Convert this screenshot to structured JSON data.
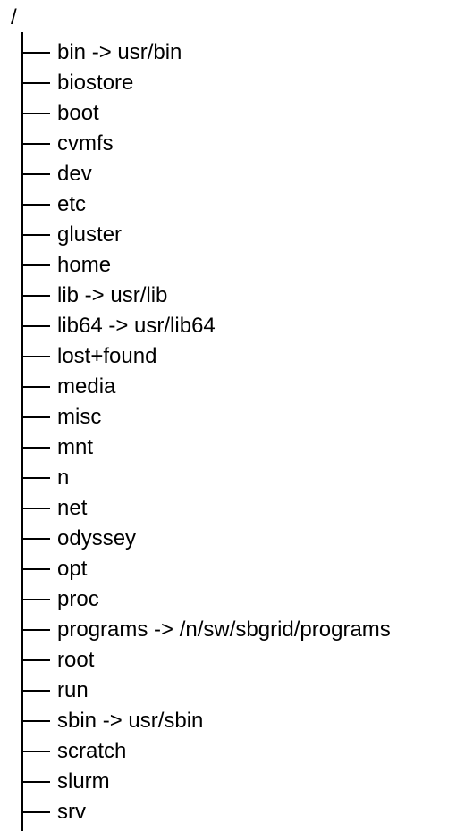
{
  "tree": {
    "root": "/",
    "items": [
      "bin -> usr/bin",
      "biostore",
      "boot",
      "cvmfs",
      "dev",
      "etc",
      "gluster",
      "home",
      "lib -> usr/lib",
      "lib64 -> usr/lib64",
      "lost+found",
      "media",
      "misc",
      "mnt",
      "n",
      "net",
      "odyssey",
      "opt",
      "proc",
      "programs -> /n/sw/sbgrid/programs",
      "root",
      "run",
      "sbin -> usr/sbin",
      "scratch",
      "slurm",
      "srv"
    ]
  }
}
